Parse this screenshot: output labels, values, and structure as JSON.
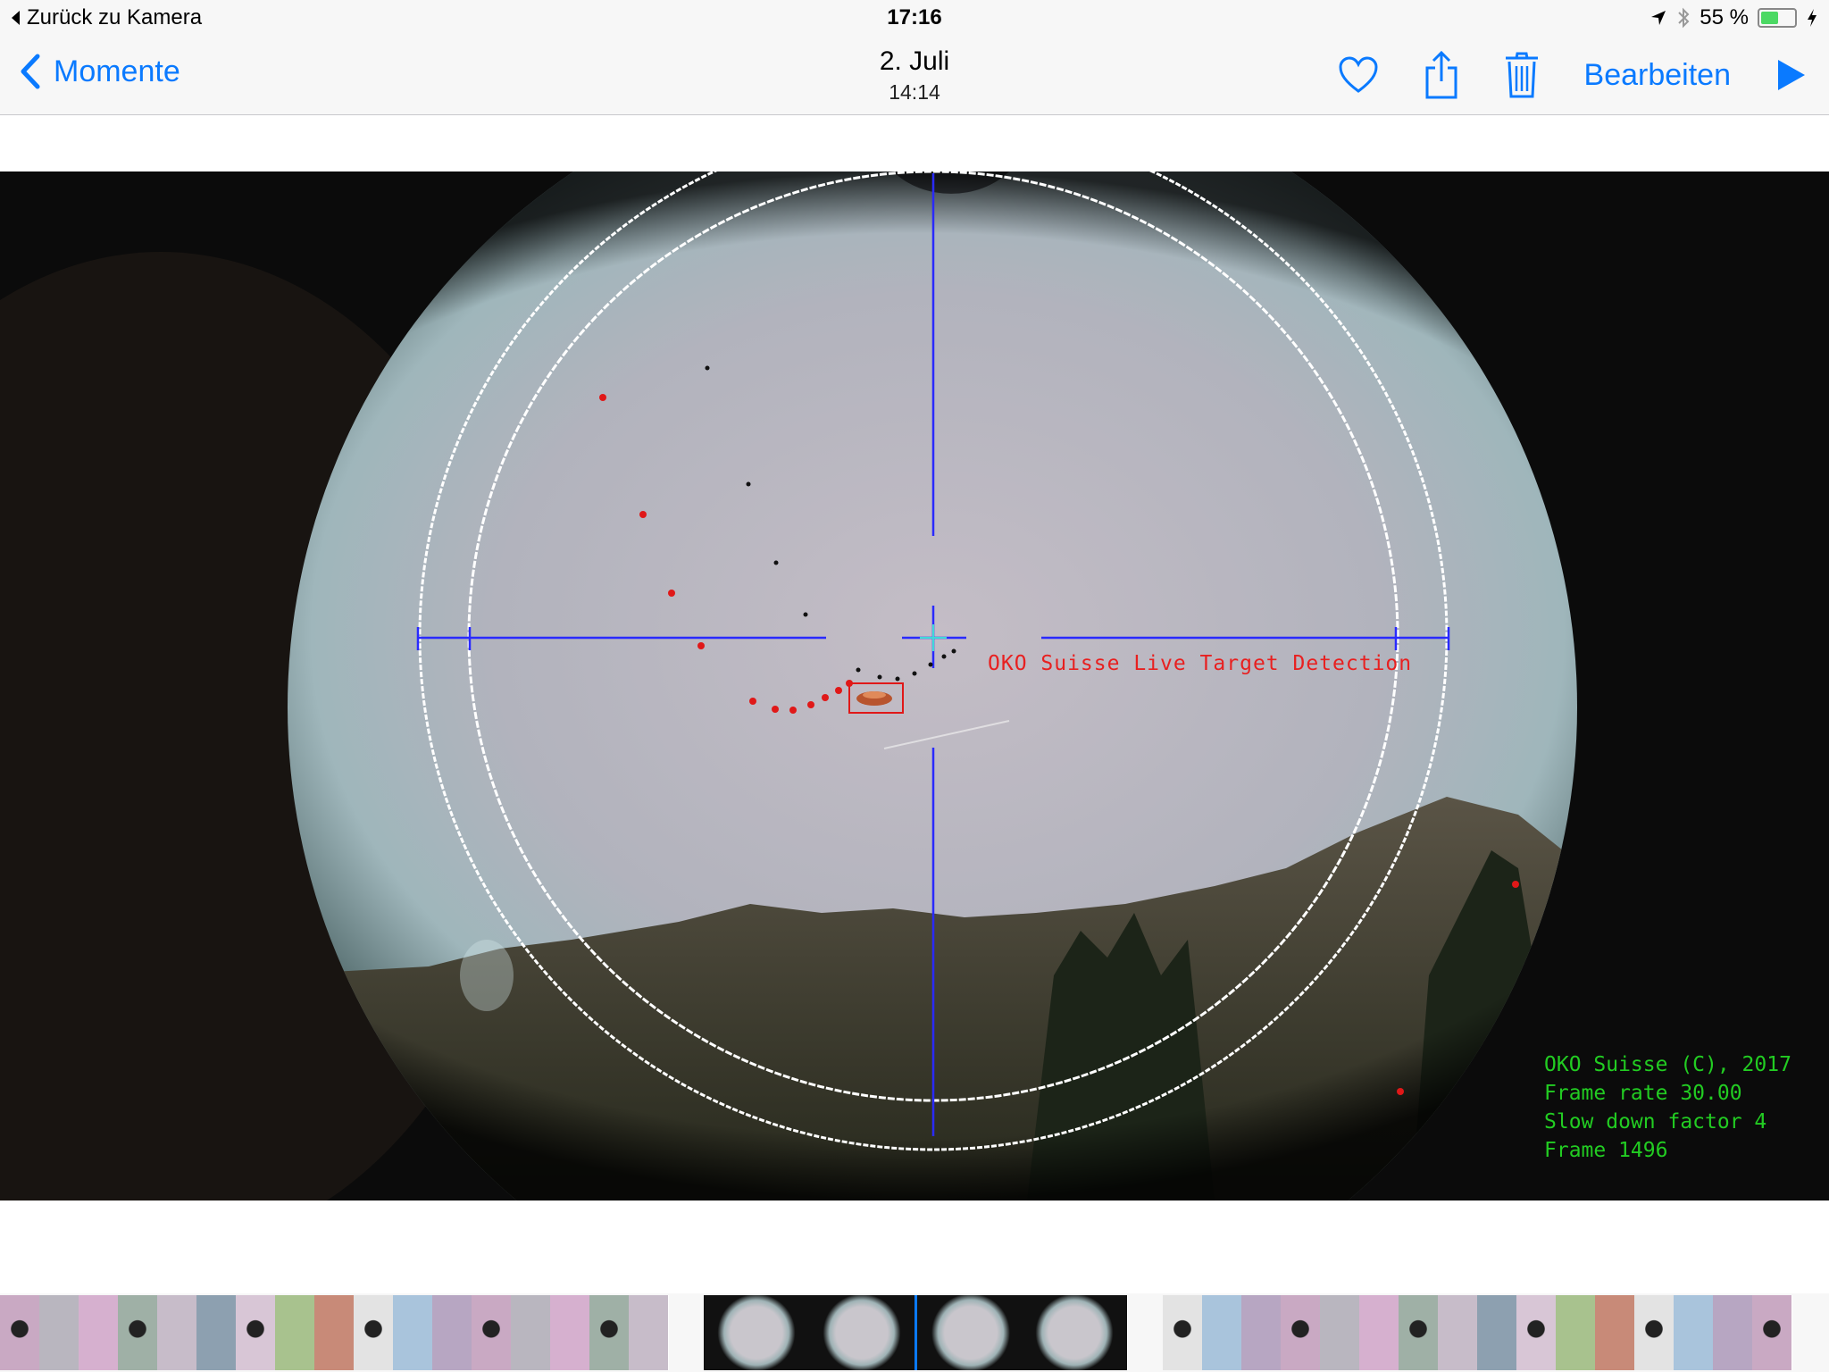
{
  "status_bar": {
    "back_label": "Zurück zu Kamera",
    "time": "17:16",
    "battery_text": "55 %",
    "battery_level": 0.55,
    "icons": [
      "location-arrow-icon",
      "bluetooth-icon",
      "battery-icon",
      "charging-bolt-icon"
    ]
  },
  "nav": {
    "back_label": "Momente",
    "title": "2. Juli",
    "subtitle": "14:14",
    "edit_label": "Bearbeiten",
    "icons": [
      "heart-icon",
      "share-icon",
      "trash-icon",
      "play-icon"
    ],
    "accent": "#0a7aff"
  },
  "photo": {
    "overlay_label": "OKO Suisse Live Target Detection",
    "info_lines": [
      "OKO Suisse (C), 2017",
      "Frame rate 30.00",
      "Slow down factor 4",
      "Frame 1496"
    ],
    "overlay_color": "#ff2222",
    "info_color": "#22cc22",
    "reticle_color": "#2a2aff"
  },
  "filmstrip": {
    "thumbnail_count": 42
  }
}
